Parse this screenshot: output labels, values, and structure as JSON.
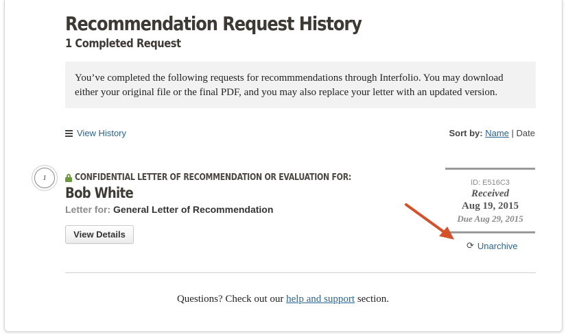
{
  "header": {
    "title": "Recommendation Request History",
    "subtitle": "1 Completed Request"
  },
  "notice": {
    "text": "You’ve completed the following requests for recommmendations through Interfolio. You may download either your original file or the final PDF, and you may also replace your letter with an updated version."
  },
  "toolbar": {
    "view_history_label": "View History",
    "list_icon": "list-icon",
    "sort_label": "Sort by:",
    "sort_name": "Name",
    "sort_separator": "|",
    "sort_date": "Date"
  },
  "request": {
    "number": "1",
    "lock_icon": "lock-icon",
    "confidential_label": "CONFIDENTIAL LETTER OF RECOMMENDATION OR EVALUATION FOR:",
    "name": "Bob White",
    "letter_for_label": "Letter for:",
    "letter_for_value": "General Letter of Recommendation",
    "view_details_label": "View Details",
    "id_text": "ID: E516C3",
    "status": "Received",
    "received_date": "Aug 19, 2015",
    "due_text": "Due Aug 29, 2015",
    "unarchive_label": "Unarchive",
    "unarchive_icon": "refresh-icon"
  },
  "footer": {
    "prefix": "Questions? Check out our",
    "link": "help and support",
    "suffix": "section."
  },
  "colors": {
    "link": "#2a6496",
    "annotation_arrow": "#d4512a",
    "lock": "#6a9a3a"
  }
}
